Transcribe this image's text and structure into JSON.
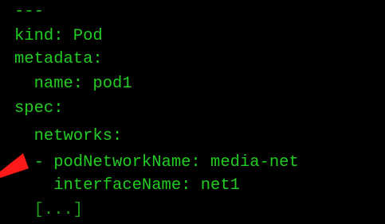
{
  "colors": {
    "background": "#000000",
    "code_text": "#22cc22",
    "ellipsis_text": "#1f9e1f",
    "arrow": "#ff1a1a"
  },
  "yaml": {
    "separator": "---",
    "kind_line": "kind: Pod",
    "metadata_key": "metadata:",
    "name_line": "  name: pod1",
    "spec_key": "spec:",
    "networks_key": "  networks:",
    "pod_network_line": "  - podNetworkName: media-net",
    "interface_line": "    interfaceName: net1",
    "ellipsis": "  [...]"
  },
  "annotation": {
    "icon": "red-pointer-arrow-icon"
  }
}
